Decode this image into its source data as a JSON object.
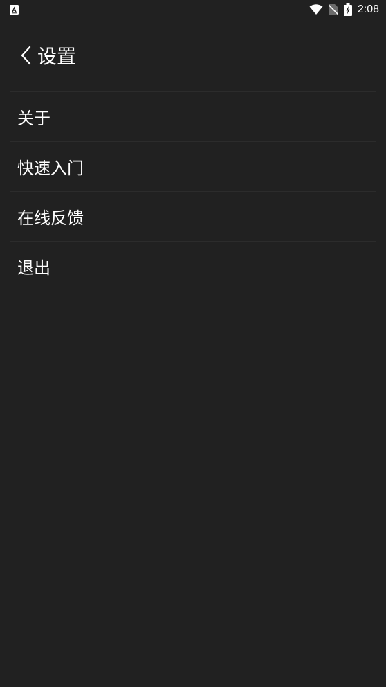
{
  "status_bar": {
    "time": "2:08",
    "icons": [
      "app-notification-icon",
      "wifi-icon",
      "no-sim-icon",
      "battery-charging-icon"
    ]
  },
  "header": {
    "title": "设置",
    "back_icon": "chevron-left-icon"
  },
  "menu": {
    "items": [
      {
        "label": "关于"
      },
      {
        "label": "快速入门"
      },
      {
        "label": "在线反馈"
      },
      {
        "label": "退出"
      }
    ]
  },
  "colors": {
    "background": "#212121",
    "text": "#ffffff",
    "divider": "#2c2c2c"
  }
}
